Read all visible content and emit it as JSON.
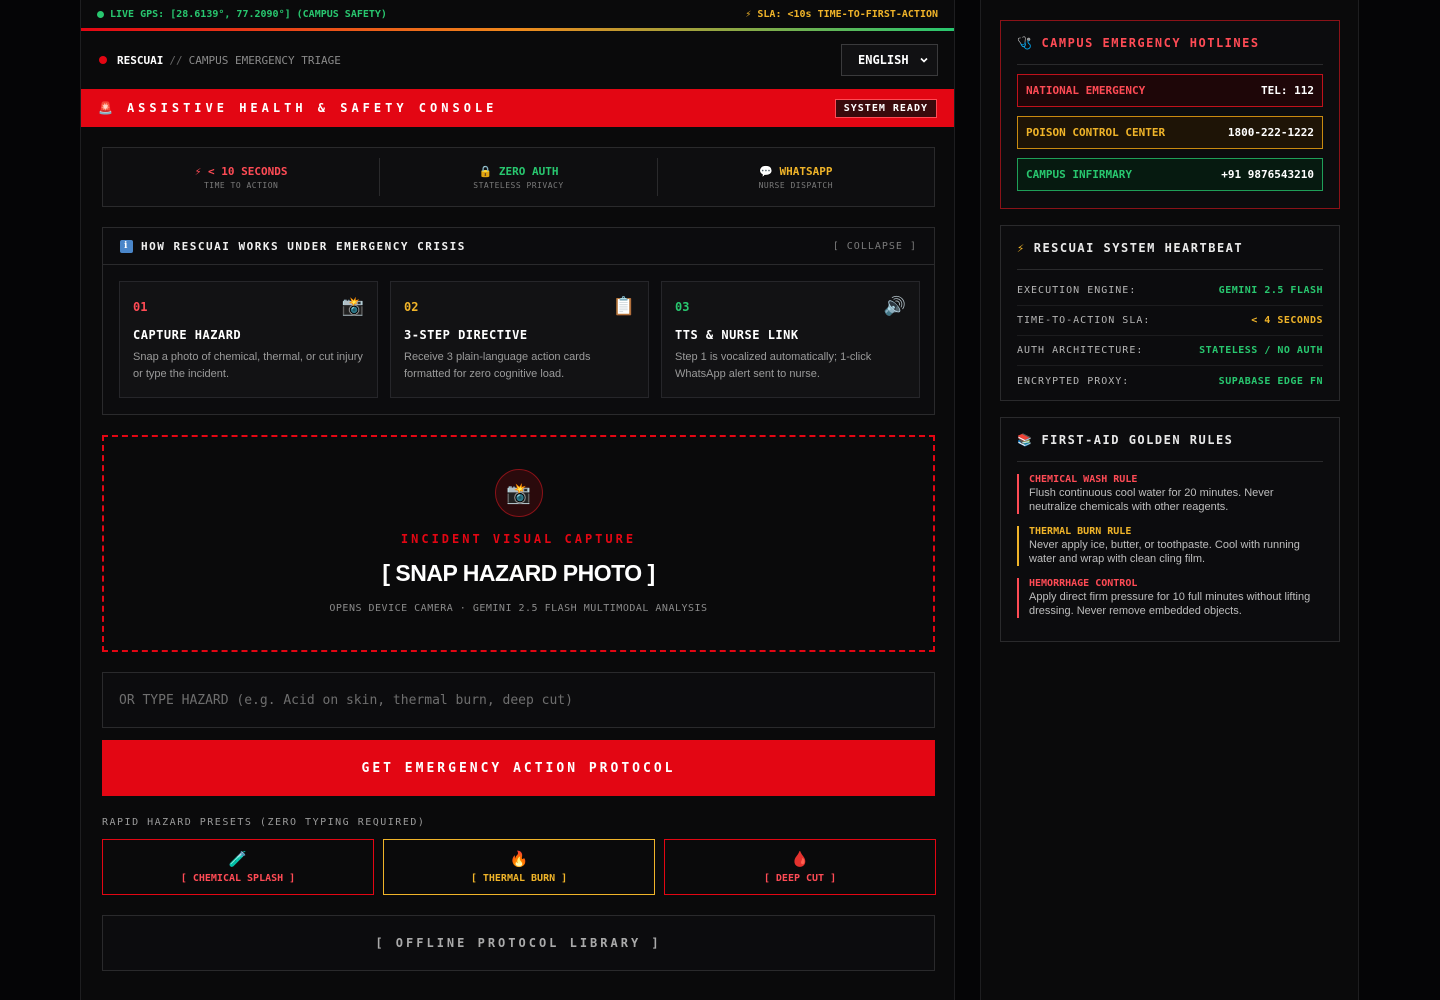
{
  "gps": {
    "text": "LIVE GPS: [28.6139°, 77.2090°] (CAMPUS SAFETY)",
    "sla": "⚡ SLA: <10s TIME-TO-FIRST-ACTION"
  },
  "header": {
    "brand": "RESCUAI",
    "sep": "//",
    "subtitle": "CAMPUS EMERGENCY TRIAGE",
    "language": "ENGLISH"
  },
  "banner": {
    "icon": "🚨",
    "title": "ASSISTIVE HEALTH & SAFETY CONSOLE",
    "badge": "SYSTEM READY"
  },
  "stats": [
    {
      "icon": "⚡",
      "title": "< 10 SECONDS",
      "sub": "TIME TO ACTION",
      "color": "#ff4b55"
    },
    {
      "icon": "🔒",
      "title": "ZERO AUTH",
      "sub": "STATELESS PRIVACY",
      "color": "#28c76f"
    },
    {
      "icon": "💬",
      "title": "WHATSAPP",
      "sub": "NURSE DISPATCH",
      "color": "#f0b429"
    }
  ],
  "how": {
    "icon": "i",
    "title": "HOW RESCUAI WORKS UNDER EMERGENCY CRISIS",
    "collapse": "[ COLLAPSE ]",
    "steps": [
      {
        "num": "01",
        "icon": "📸",
        "title": "CAPTURE HAZARD",
        "desc": "Snap a photo of chemical, thermal, or cut injury or type the incident.",
        "color": "#ff4b55"
      },
      {
        "num": "02",
        "icon": "📋",
        "title": "3-STEP DIRECTIVE",
        "desc": "Receive 3 plain-language action cards formatted for zero cognitive load.",
        "color": "#f0b429"
      },
      {
        "num": "03",
        "icon": "🔊",
        "title": "TTS & NURSE LINK",
        "desc": "Step 1 is vocalized automatically; 1-click WhatsApp alert sent to nurse.",
        "color": "#28c76f"
      }
    ]
  },
  "capture": {
    "icon": "📸",
    "label": "INCIDENT VISUAL CAPTURE",
    "title": "[ SNAP HAZARD PHOTO ]",
    "sub": "OPENS DEVICE CAMERA · GEMINI 2.5 FLASH MULTIMODAL ANALYSIS"
  },
  "hazard_input": {
    "placeholder": "OR TYPE HAZARD (e.g. Acid on skin, thermal burn, deep cut)",
    "value": ""
  },
  "cta": {
    "label": "GET EMERGENCY ACTION PROTOCOL"
  },
  "presets": {
    "label": "RAPID HAZARD PRESETS (ZERO TYPING REQUIRED)",
    "items": [
      {
        "icon": "🧪",
        "label": "[ CHEMICAL SPLASH ]",
        "color": "#ff4b55"
      },
      {
        "icon": "🔥",
        "label": "[ THERMAL BURN ]",
        "color": "#f0b429"
      },
      {
        "icon": "🩸",
        "label": "[ DEEP CUT ]",
        "color": "#ff4b55"
      }
    ]
  },
  "offline": {
    "label": "[ OFFLINE PROTOCOL LIBRARY ]"
  },
  "hotlines": {
    "icon": "🩺",
    "title": "CAMPUS EMERGENCY HOTLINES",
    "items": [
      {
        "name": "NATIONAL EMERGENCY",
        "number": "TEL: 112",
        "color": "#ff4b55",
        "bg": "#1e0608"
      },
      {
        "name": "POISON CONTROL CENTER",
        "number": "1800-222-1222",
        "color": "#f0b429",
        "bg": "#1e1406"
      },
      {
        "name": "CAMPUS INFIRMARY",
        "number": "+91 9876543210",
        "color": "#28c76f",
        "bg": "#061a10"
      }
    ]
  },
  "heartbeat": {
    "icon": "⚡",
    "title": "RESCUAI SYSTEM HEARTBEAT",
    "rows": [
      {
        "key": "EXECUTION ENGINE:",
        "value": "GEMINI 2.5 FLASH",
        "color": "#28c76f"
      },
      {
        "key": "TIME-TO-ACTION SLA:",
        "value": "< 4 SECONDS",
        "color": "#f0b429"
      },
      {
        "key": "AUTH ARCHITECTURE:",
        "value": "STATELESS / NO AUTH",
        "color": "#28c76f"
      },
      {
        "key": "ENCRYPTED PROXY:",
        "value": "SUPABASE EDGE FN",
        "color": "#28c76f"
      }
    ]
  },
  "rules": {
    "icon": "📚",
    "title": "FIRST-AID GOLDEN RULES",
    "items": [
      {
        "title": "CHEMICAL WASH RULE",
        "desc": "Flush continuous cool water for 20 minutes. Never neutralize chemicals with other reagents.",
        "color": "#ff4b55"
      },
      {
        "title": "THERMAL BURN RULE",
        "desc": "Never apply ice, butter, or toothpaste. Cool with running water and wrap with clean cling film.",
        "color": "#f0b429"
      },
      {
        "title": "HEMORRHAGE CONTROL",
        "desc": "Apply direct firm pressure for 10 full minutes without lifting dressing. Never remove embedded objects.",
        "color": "#ff4b55"
      }
    ]
  }
}
